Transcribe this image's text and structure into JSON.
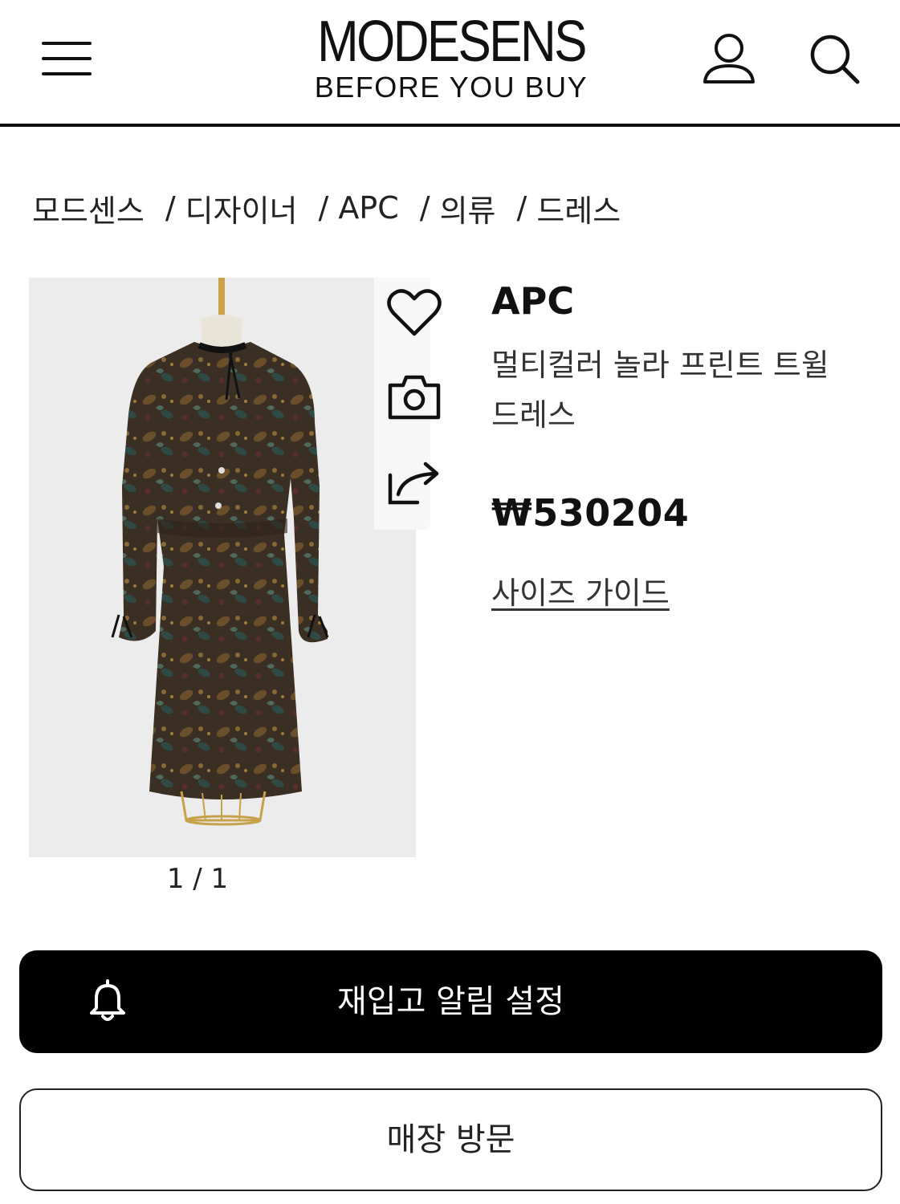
{
  "header": {
    "logo_main": "MODESENS",
    "logo_sub": "BEFORE YOU BUY",
    "icons": [
      "menu-icon",
      "user-icon",
      "search-icon"
    ]
  },
  "breadcrumb": {
    "items": [
      "모드센스",
      "디자이너",
      "APC",
      "의류",
      "드레스"
    ],
    "separator": "/"
  },
  "gallery": {
    "counter": "1 / 1"
  },
  "actions": {
    "icons": [
      "heart-icon",
      "camera-icon",
      "share-icon"
    ]
  },
  "product": {
    "brand": "APC",
    "name": "멀티컬러 놀라 프린트 트윌 드레스",
    "price": "₩530204",
    "size_guide_label": "사이즈 가이드"
  },
  "buttons": {
    "restock_label": "재입고 알림 설정",
    "restock_icon": "bell-icon",
    "store_label": "매장 방문"
  },
  "colors": {
    "primary": "#000000",
    "background": "#ffffff",
    "image_bg": "#ececec"
  }
}
